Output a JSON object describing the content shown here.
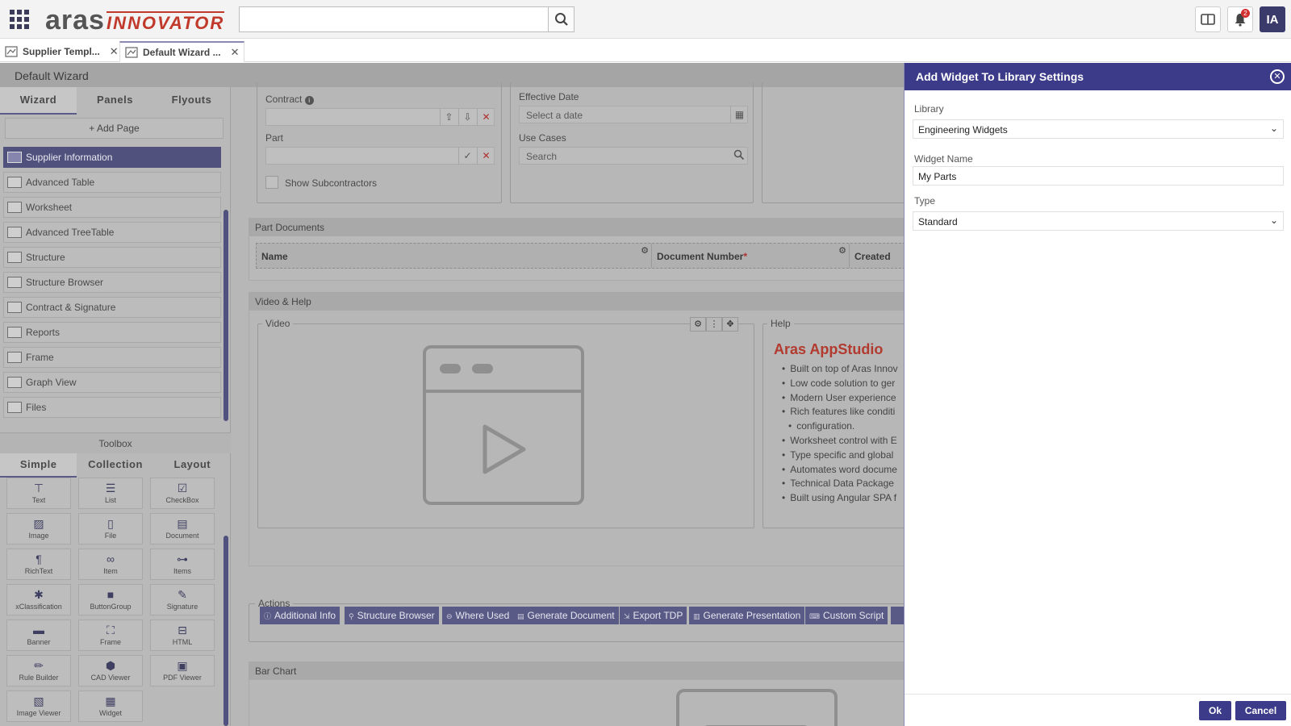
{
  "header": {
    "logo_primary": "aras",
    "logo_secondary": "INNOVATOR",
    "search_value": "",
    "notification_count": "2",
    "user_initials": "IA"
  },
  "tabs": [
    {
      "label": "Supplier Templ...",
      "active": false
    },
    {
      "label": "Default Wizard ...",
      "active": true
    }
  ],
  "wizard": {
    "title": "Default Wizard",
    "panel_tabs": [
      "Wizard",
      "Panels",
      "Flyouts"
    ],
    "add_page_label": "+ Add Page",
    "pages": [
      "Supplier Information",
      "Advanced Table",
      "Worksheet",
      "Advanced TreeTable",
      "Structure",
      "Structure Browser",
      "Contract & Signature",
      "Reports",
      "Frame",
      "Graph View",
      "Files"
    ],
    "selected_page": "Supplier Information",
    "toolbox_title": "Toolbox",
    "toolbox_tabs": [
      "Simple",
      "Collection",
      "Layout"
    ],
    "tools": [
      {
        "label": "Text",
        "icon": "text-icon"
      },
      {
        "label": "List",
        "icon": "list-icon"
      },
      {
        "label": "CheckBox",
        "icon": "checkbox-icon"
      },
      {
        "label": "Image",
        "icon": "image-icon"
      },
      {
        "label": "File",
        "icon": "file-icon"
      },
      {
        "label": "Document",
        "icon": "document-icon"
      },
      {
        "label": "RichText",
        "icon": "paragraph-icon"
      },
      {
        "label": "Item",
        "icon": "link-icon"
      },
      {
        "label": "Items",
        "icon": "hierarchy-icon"
      },
      {
        "label": "xClassification",
        "icon": "asterisk-icon"
      },
      {
        "label": "ButtonGroup",
        "icon": "square-icon"
      },
      {
        "label": "Signature",
        "icon": "edit-icon"
      },
      {
        "label": "Banner",
        "icon": "banner-icon"
      },
      {
        "label": "Frame",
        "icon": "frame-icon"
      },
      {
        "label": "HTML",
        "icon": "html-icon"
      },
      {
        "label": "Rule Builder",
        "icon": "pencil-icon"
      },
      {
        "label": "CAD Viewer",
        "icon": "cube-icon"
      },
      {
        "label": "PDF Viewer",
        "icon": "pdf-icon"
      },
      {
        "label": "Image Viewer",
        "icon": "image-file-icon"
      },
      {
        "label": "Widget",
        "icon": "widget-icon"
      }
    ]
  },
  "canvas": {
    "contract_label": "Contract",
    "part_label": "Part",
    "show_subcontractors_label": "Show Subcontractors",
    "effective_date_label": "Effective Date",
    "effective_date_placeholder": "Select a date",
    "use_cases_label": "Use Cases",
    "use_cases_placeholder": "Search",
    "part_documents_title": "Part Documents",
    "table_headers": [
      "Name",
      "Document Number",
      "Created"
    ],
    "required_marker": "*",
    "video_help_title": "Video & Help",
    "video_legend": "Video",
    "help_legend": "Help",
    "help_title": "Aras AppStudio",
    "help_items": [
      "Built on top of Aras Innov",
      "Low code solution to ger",
      "Modern User experience",
      "Rich features like conditi",
      "configuration.",
      "Worksheet control with E",
      "Type specific and global",
      "Automates word docume",
      "Technical Data Package",
      "Built using Angular SPA f"
    ],
    "actions_legend": "Actions",
    "actions": [
      "Additional Info",
      "Structure Browser",
      "Where Used",
      "Generate Document",
      "Export TDP",
      "Generate Presentation",
      "Custom Script"
    ],
    "bar_chart_title": "Bar Chart"
  },
  "dialog": {
    "title": "Add Widget To Library Settings",
    "library_label": "Library",
    "library_value": "Engineering Widgets",
    "widget_name_label": "Widget Name",
    "widget_name_value": "My Parts",
    "type_label": "Type",
    "type_value": "Standard",
    "ok_label": "Ok",
    "cancel_label": "Cancel"
  },
  "colors": {
    "accent": "#3b3b8a",
    "selected_item": "#51517d",
    "help_title": "#b23a2e"
  }
}
